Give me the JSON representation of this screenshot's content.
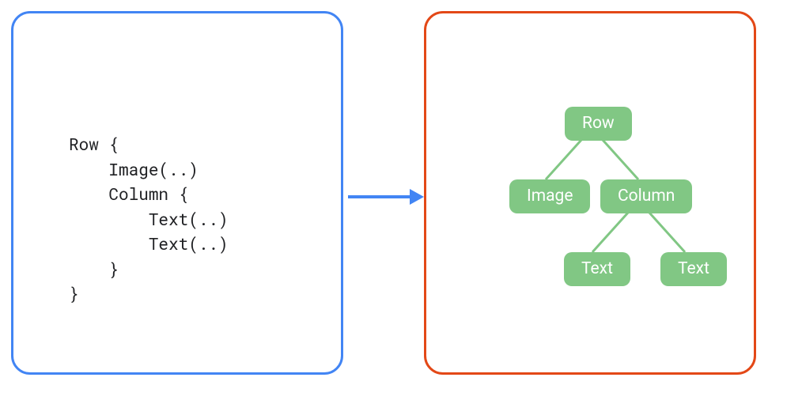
{
  "code": {
    "lines": [
      "Row {",
      "    Image(..)",
      "    Column {",
      "        Text(..)",
      "        Text(..)",
      "    }",
      "}"
    ]
  },
  "tree": {
    "nodes": {
      "root": "Row",
      "child_left": "Image",
      "child_right": "Column",
      "grand_left": "Text",
      "grand_right": "Text"
    }
  },
  "colors": {
    "left_border": "#4285F4",
    "right_border": "#E34817",
    "arrow": "#4285F4",
    "node_bg": "#81C784",
    "node_text": "#ffffff"
  }
}
